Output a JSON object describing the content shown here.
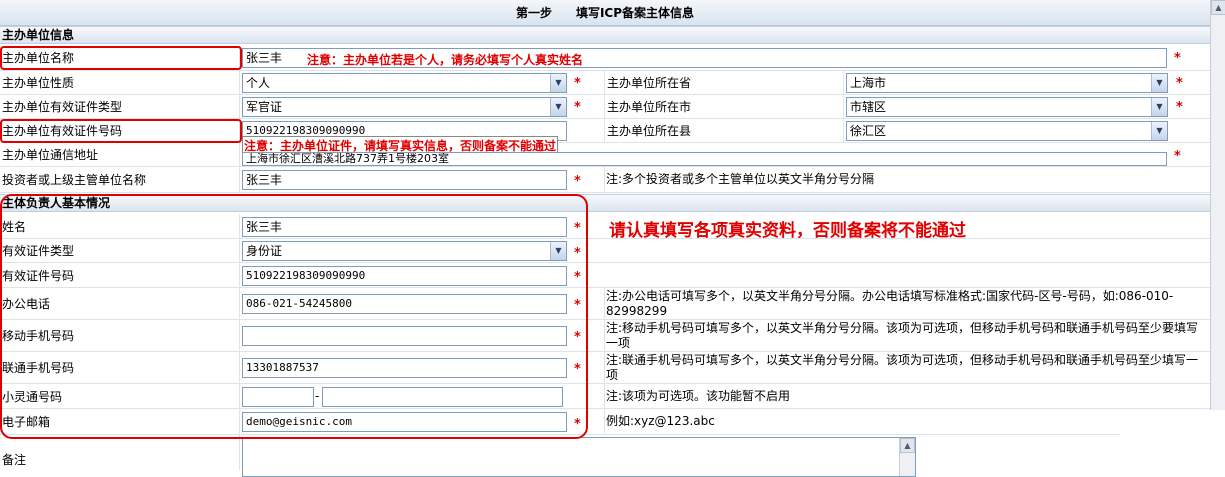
{
  "title": "第一步　　填写ICP备案主体信息",
  "sections": {
    "sponsor": "主办单位信息",
    "principal": "主体负责人基本情况"
  },
  "sponsor": {
    "name_label": "主办单位名称",
    "name_value": "张三丰",
    "name_warning": "注意：主办单位若是个人，请务必填写个人真实姓名",
    "nature_label": "主办单位性质",
    "nature_value": "个人",
    "province_label": "主办单位所在省",
    "province_value": "上海市",
    "cert_type_label": "主办单位有效证件类型",
    "cert_type_value": "军官证",
    "city_label": "主办单位所在市",
    "city_value": "市辖区",
    "cert_no_label": "主办单位有效证件号码",
    "cert_no_value": "510922198309090990",
    "cert_warning": "注意：主办单位证件，请填写真实信息，否则备案不能通过",
    "county_label": "主办单位所在县",
    "county_value": "徐汇区",
    "address_label": "主办单位通信地址",
    "address_value": "上海市徐汇区漕溪北路737弄1号楼203室",
    "investor_label": "投资者或上级主管单位名称",
    "investor_value": "张三丰",
    "investor_note": "注:多个投资者或多个主管单位以英文半角分号分隔"
  },
  "principal": {
    "big_warning": "请认真填写各项真实资料，否则备案将不能通过",
    "name_label": "姓名",
    "name_value": "张三丰",
    "cert_type_label": "有效证件类型",
    "cert_type_value": "身份证",
    "cert_no_label": "有效证件号码",
    "cert_no_value": "510922198309090990",
    "office_phone_label": "办公电话",
    "office_phone_value": "086-021-54245800",
    "office_phone_note": "注:办公电话可填写多个，以英文半角分号分隔。办公电话填写标准格式:国家代码-区号-号码，如:086-010-82998299",
    "mobile_label": "移动手机号码",
    "mobile_value": "",
    "mobile_note": "注:移动手机号码可填写多个，以英文半角分号分隔。该项为可选项，但移动手机号码和联通手机号码至少要填写一项",
    "unicom_label": "联通手机号码",
    "unicom_value": "13301887537",
    "unicom_note": "注:联通手机号码可填写多个，以英文半角分号分隔。该项为可选项，但移动手机号码和联通手机号码至少填写一项",
    "phs_label": "小灵通号码",
    "phs_area": "",
    "phs_number": "",
    "phs_sep": "-",
    "phs_note": "注:该项为可选项。该功能暂不启用",
    "email_label": "电子邮箱",
    "email_value": "demo@geisnic.com",
    "email_note": "例如:xyz@123.abc"
  },
  "remark": {
    "label": "备注",
    "value": ""
  },
  "required_mark": "*",
  "colors": {
    "required": "#e00000",
    "section_bg": "#dbe4ef",
    "input_border": "#7f9db9"
  },
  "icons": {
    "dropdown": "chevron-down-icon",
    "scroll_up": "scroll-up-icon"
  }
}
